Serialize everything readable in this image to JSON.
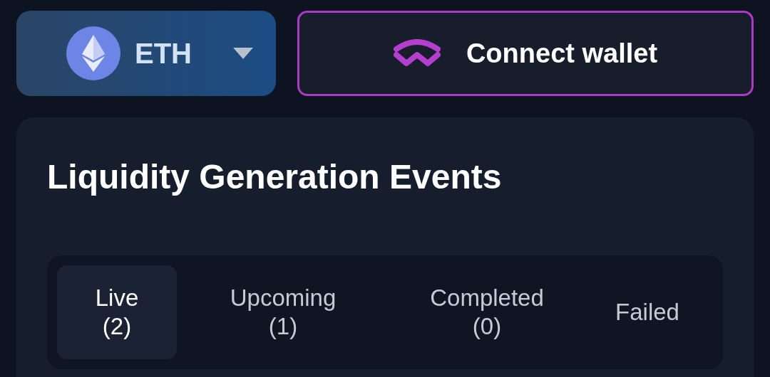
{
  "network_selector": {
    "label": "ETH"
  },
  "connect_button": {
    "label": "Connect wallet"
  },
  "panel": {
    "title": "Liquidity Generation Events",
    "tabs": [
      {
        "label": "Live",
        "count": "(2)",
        "selected": true
      },
      {
        "label": "Upcoming",
        "count": "(1)",
        "selected": false
      },
      {
        "label": "Completed",
        "count": "(0)",
        "selected": false
      },
      {
        "label": "Failed",
        "selected": false
      }
    ]
  }
}
